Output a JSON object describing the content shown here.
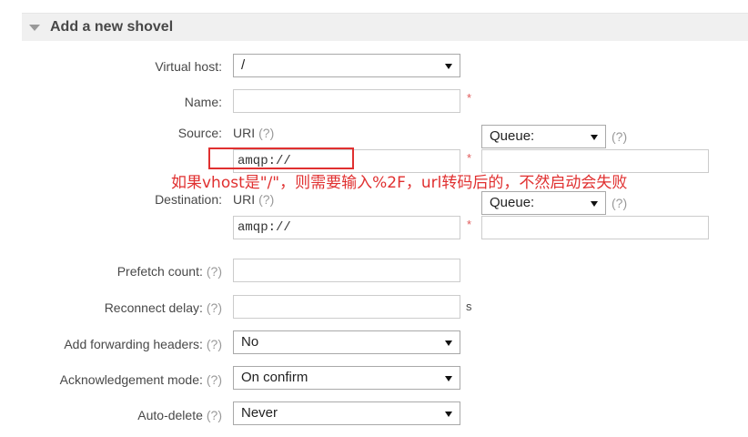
{
  "section": {
    "title": "Add a new shovel"
  },
  "help_glyph": "(?)",
  "required_mark": "*",
  "fields": {
    "virtual_host": {
      "label": "Virtual host:",
      "value": "/"
    },
    "name": {
      "label": "Name:",
      "value": ""
    },
    "source": {
      "label": "Source:",
      "uri_label": "URI",
      "uri_value": "amqp://",
      "type": "Queue:",
      "queue_value": ""
    },
    "destination": {
      "label": "Destination:",
      "uri_label": "URI",
      "uri_value": "amqp://",
      "type": "Queue:",
      "queue_value": ""
    },
    "prefetch_count": {
      "label": "Prefetch count:",
      "value": ""
    },
    "reconnect_delay": {
      "label": "Reconnect delay:",
      "value": "",
      "unit": "s"
    },
    "add_forwarding_headers": {
      "label": "Add forwarding headers:",
      "value": "No"
    },
    "ack_mode": {
      "label": "Acknowledgement mode:",
      "value": "On confirm"
    },
    "auto_delete": {
      "label": "Auto-delete",
      "value": "Never"
    }
  },
  "annotation": {
    "text": "如果vhost是\"/\"，则需要输入%2F，url转码后的，不然启动会失败"
  },
  "colors": {
    "annotation": "#e03030",
    "required": "#e05a5a",
    "header_bg": "#f0f0f0"
  }
}
